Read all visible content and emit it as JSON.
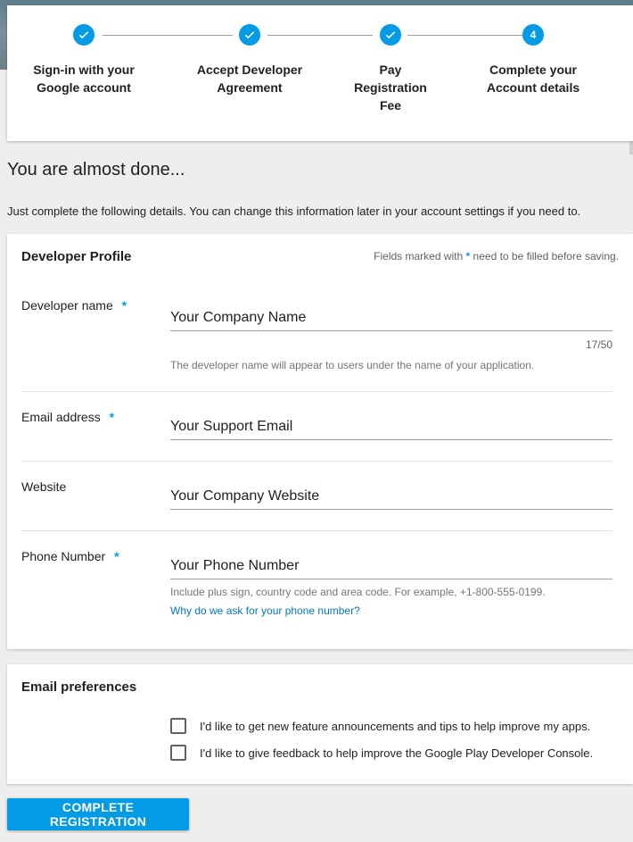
{
  "stepper": {
    "steps": [
      {
        "label": "Sign-in with your\nGoogle account",
        "state": "done",
        "icon": "check-icon"
      },
      {
        "label": "Accept Developer\nAgreement",
        "state": "done",
        "icon": "check-icon"
      },
      {
        "label": "Pay\nRegistration\nFee",
        "state": "done",
        "icon": "check-icon"
      },
      {
        "label": "Complete your\nAccount details",
        "state": "current",
        "number": "4"
      }
    ]
  },
  "page": {
    "title": "You are almost done...",
    "subtitle": "Just complete the following details. You can change this information later in your account settings if you need to."
  },
  "profile": {
    "heading": "Developer Profile",
    "hint_prefix": "Fields marked with",
    "hint_star": "*",
    "hint_suffix": "need to be filled before saving.",
    "developer_name": {
      "label": "Developer name",
      "required": "*",
      "placeholder": "Your Company Name",
      "counter": "17/50",
      "help": "The developer name will appear to users under the name of your application."
    },
    "email": {
      "label": "Email address",
      "required": "*",
      "placeholder": "Your Support Email"
    },
    "website": {
      "label": "Website",
      "placeholder": "Your Company Website"
    },
    "phone": {
      "label": "Phone Number",
      "required": "*",
      "placeholder": "Your Phone Number",
      "help": "Include plus sign, country code and area code. For example, +1-800-555-0199.",
      "link": "Why do we ask for your phone number?"
    }
  },
  "email_prefs": {
    "heading": "Email preferences",
    "options": [
      {
        "label": "I'd like to get new feature announcements and tips to help improve my apps.",
        "checked": false
      },
      {
        "label": "I'd like to give feedback to help improve the Google Play Developer Console.",
        "checked": false
      }
    ]
  },
  "actions": {
    "complete_label": "COMPLETE REGISTRATION"
  },
  "colors": {
    "accent": "#039be5",
    "link": "#0277bd"
  }
}
